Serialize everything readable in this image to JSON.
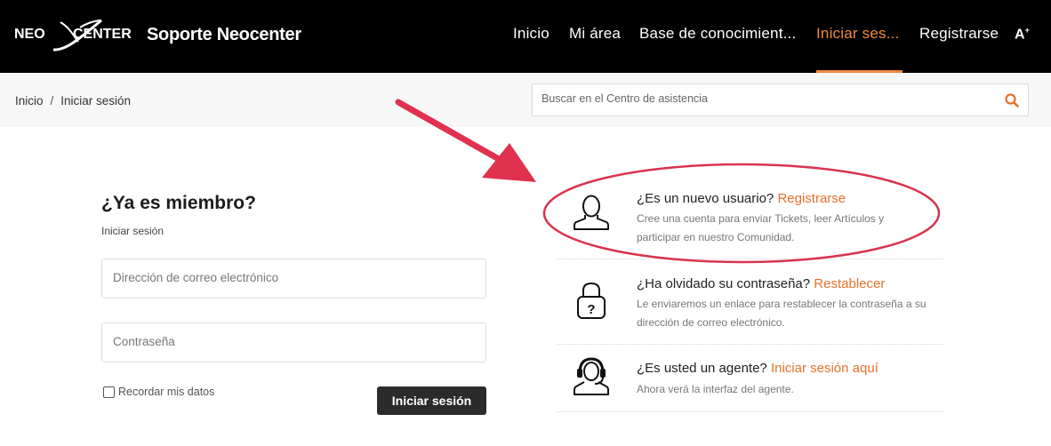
{
  "header": {
    "logo_text_left": "NEO",
    "logo_text_right": "CENTER",
    "title": "Soporte Neocenter",
    "nav": [
      {
        "label": "Inicio"
      },
      {
        "label": "Mi área"
      },
      {
        "label": "Base de conocimient..."
      },
      {
        "label": "Iniciar ses...",
        "active": true
      },
      {
        "label": "Registrarse"
      }
    ],
    "a11y_label": "A",
    "accent_color": "#f08a3c"
  },
  "breadcrumb": {
    "home": "Inicio",
    "separator": "/",
    "current": "Iniciar sesión"
  },
  "search": {
    "placeholder": "Buscar en el Centro de asistencia",
    "icon": "search-icon"
  },
  "login": {
    "title": "¿Ya es miembro?",
    "subtitle": "Iniciar sesión",
    "email_placeholder": "Dirección de correo electrónico",
    "password_placeholder": "Contraseña",
    "remember_label": "Recordar mis datos",
    "submit_label": "Iniciar sesión"
  },
  "options": [
    {
      "icon": "user-icon",
      "question": "¿Es un nuevo usuario?",
      "link": "Registrarse",
      "description": "Cree una cuenta para enviar Tickets, leer Artículos y participar en nuestro Comunidad."
    },
    {
      "icon": "lock-question-icon",
      "question": "¿Ha olvidado su contraseña?",
      "link": "Restablecer",
      "description": "Le enviaremos un enlace para restablecer la contraseña a su dirección de correo electrónico."
    },
    {
      "icon": "headset-agent-icon",
      "question": "¿Es usted un agente?",
      "link": "Iniciar sesión aquí",
      "description": "Ahora verá la interfaz del agente."
    }
  ],
  "annotation": {
    "arrow_color": "#e0314f",
    "ellipse_color": "#d9334f"
  }
}
